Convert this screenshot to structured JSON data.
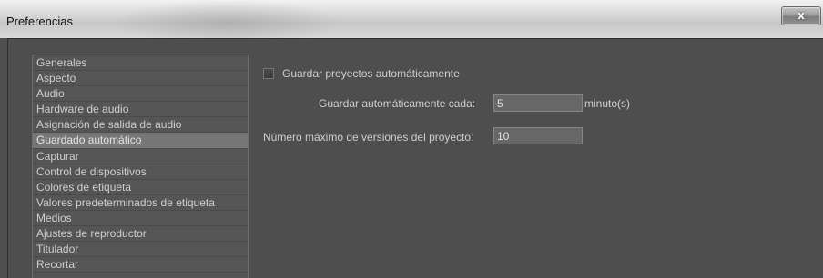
{
  "window": {
    "title": "Preferencias",
    "close_glyph": "x"
  },
  "sidebar": {
    "items": [
      {
        "label": "Generales",
        "selected": false
      },
      {
        "label": "Aspecto",
        "selected": false
      },
      {
        "label": "Audio",
        "selected": false
      },
      {
        "label": "Hardware de audio",
        "selected": false
      },
      {
        "label": "Asignación de salida de audio",
        "selected": false
      },
      {
        "label": "Guardado automático",
        "selected": true
      },
      {
        "label": "Capturar",
        "selected": false
      },
      {
        "label": "Control de dispositivos",
        "selected": false
      },
      {
        "label": "Colores de etiqueta",
        "selected": false
      },
      {
        "label": "Valores predeterminados de etiqueta",
        "selected": false
      },
      {
        "label": "Medios",
        "selected": false
      },
      {
        "label": "Ajustes de reproductor",
        "selected": false
      },
      {
        "label": "Titulador",
        "selected": false
      },
      {
        "label": "Recortar",
        "selected": false
      }
    ]
  },
  "autosave": {
    "checkbox_label": "Guardar proyectos automáticamente",
    "checked": false,
    "interval_label": "Guardar automáticamente cada:",
    "interval_value": "5",
    "interval_unit": "minuto(s)",
    "max_versions_label": "Número máximo de versiones del proyecto:",
    "max_versions_value": "10"
  },
  "colors": {
    "selected_row": "#777777",
    "panel_background": "#4e4e4e"
  }
}
